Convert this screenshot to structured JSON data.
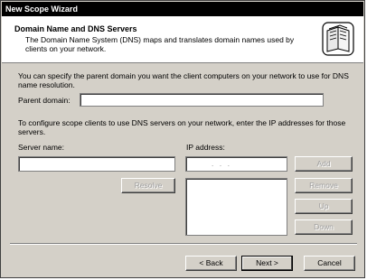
{
  "window": {
    "title": "New Scope Wizard"
  },
  "header": {
    "title": "Domain Name and DNS Servers",
    "description": "The Domain Name System (DNS) maps and translates domain names used by clients on your network."
  },
  "intro_text": "You can specify the parent domain you want the client computers on your network to use for DNS name resolution.",
  "parent_domain": {
    "label": "Parent domain:",
    "value": ""
  },
  "configure_text": "To configure scope clients to use DNS servers on your network, enter the IP addresses for those servers.",
  "server_name": {
    "label": "Server name:",
    "value": ""
  },
  "ip_address": {
    "label": "IP address:",
    "value": ".   .   ."
  },
  "buttons": {
    "resolve": "Resolve",
    "add": "Add",
    "remove": "Remove",
    "up": "Up",
    "down": "Down",
    "back": "< Back",
    "next": "Next >",
    "cancel": "Cancel"
  },
  "icons": {
    "header": "book-pages-icon"
  }
}
